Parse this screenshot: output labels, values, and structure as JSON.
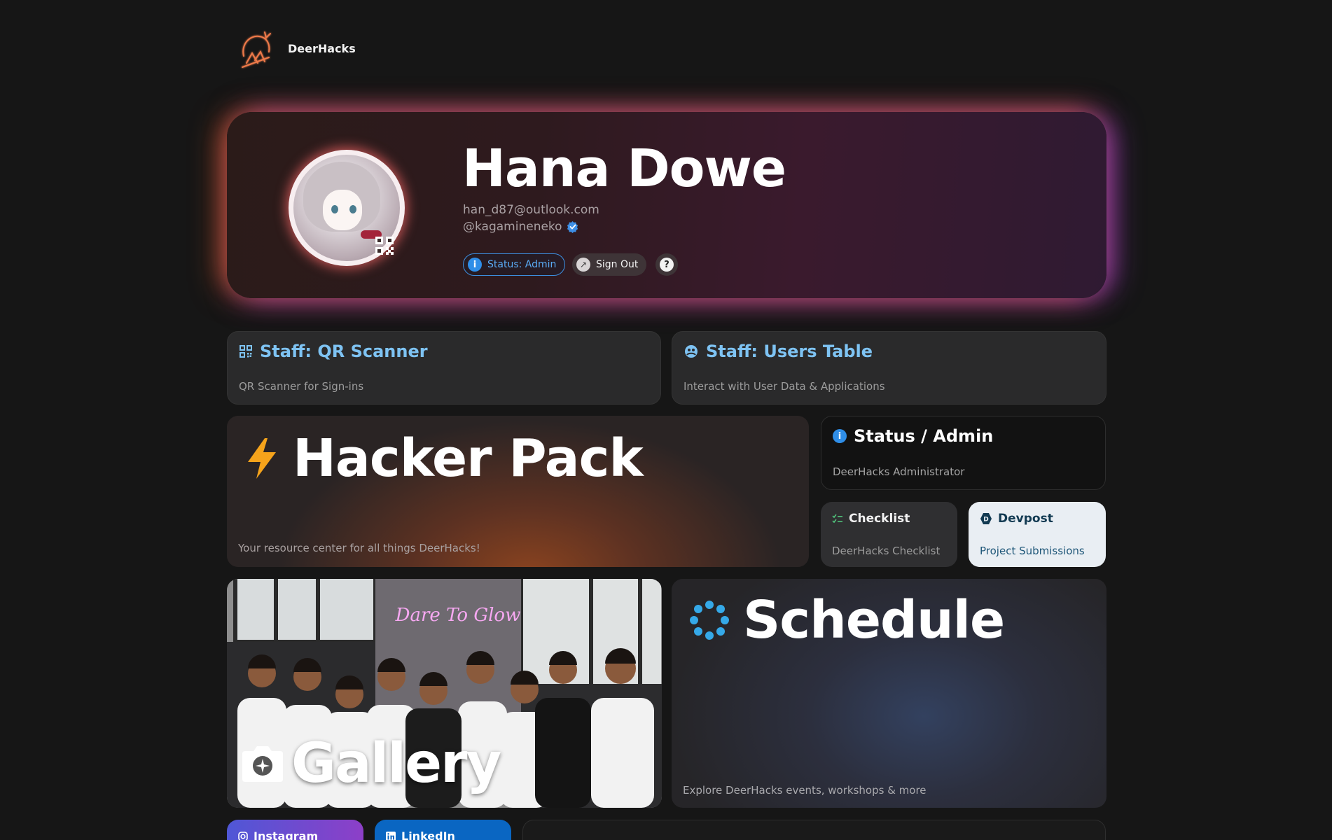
{
  "header": {
    "brand": "DeerHacks"
  },
  "profile": {
    "name": "Hana Dowe",
    "email": "han_d87@outlook.com",
    "handle": "@kagamineneko",
    "status_label": "Status: Admin",
    "signout_label": "Sign Out",
    "help_label": "?"
  },
  "cards": {
    "qr": {
      "title": "Staff: QR Scanner",
      "subtitle": "QR Scanner for Sign-ins"
    },
    "users": {
      "title": "Staff: Users Table",
      "subtitle": "Interact with User Data & Applications"
    },
    "hacker_pack": {
      "title": "Hacker Pack",
      "subtitle": "Your resource center for all things DeerHacks!"
    },
    "status": {
      "title": "Status / Admin",
      "subtitle": "DeerHacks Administrator"
    },
    "checklist": {
      "title": "Checklist",
      "subtitle": "DeerHacks Checklist"
    },
    "devpost": {
      "title": "Devpost",
      "subtitle": "Project Submissions"
    },
    "gallery": {
      "title": "Gallery",
      "sign_text": "Dare To Glow"
    },
    "schedule": {
      "title": "Schedule",
      "subtitle": "Explore DeerHacks events, workshops & more"
    },
    "instagram": {
      "title": "Instagram"
    },
    "linkedin": {
      "title": "LinkedIn"
    }
  },
  "colors": {
    "background": "#161616",
    "accent_blue": "#7ec3f3",
    "status_blue": "#2f8ee8",
    "hacker_orange": "#8a431f",
    "lightning": "#f5a31b",
    "schedule_dots": "#35a9e8"
  },
  "icons": [
    "deer-logo-icon",
    "qr-code-icon",
    "verified-icon",
    "info-icon",
    "external-link-icon",
    "help-icon",
    "users-icon",
    "lightning-icon",
    "checklist-icon",
    "devpost-icon",
    "camera-icon",
    "dots-cluster-icon",
    "instagram-icon",
    "linkedin-icon"
  ]
}
